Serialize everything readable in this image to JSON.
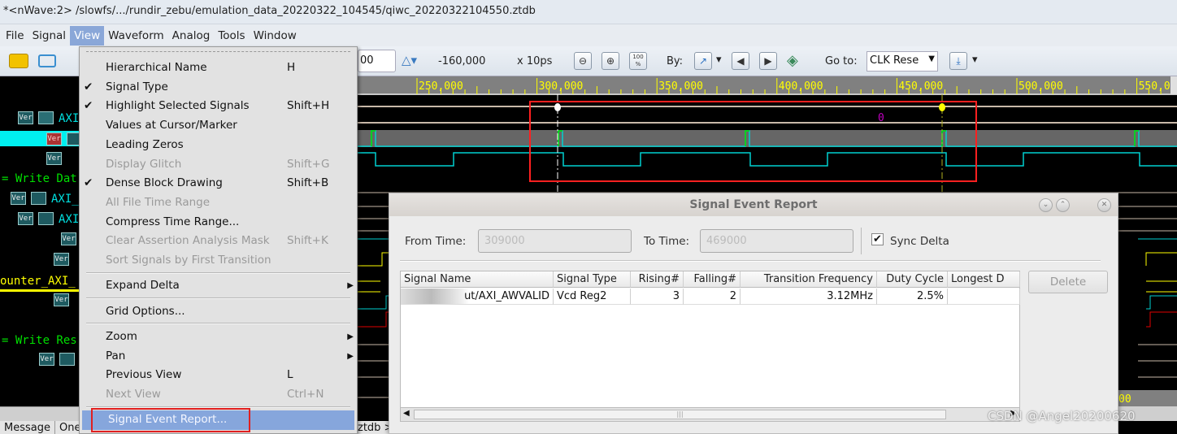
{
  "window": {
    "title": "*<nWave:2> /slowfs/.../rundir_zebu/emulation_data_20220322_104545/qiwc_20220322104550.ztdb"
  },
  "menubar": [
    "File",
    "Signal",
    "View",
    "Waveform",
    "Analog",
    "Tools",
    "Window"
  ],
  "toolbar": {
    "cursor_time_fragment": "00",
    "delta_value": "-160,000",
    "time_unit": "x 10ps",
    "zoom_100_label": "100 %",
    "by_label": "By:",
    "goto_label": "Go to:",
    "goto_value": "CLK Rese"
  },
  "ruler": {
    "ticks": [
      "250,000",
      "300,000",
      "350,000",
      "400,000",
      "450,000",
      "500,000",
      "550,000"
    ],
    "bottom_fragment": "00"
  },
  "waveform": {
    "value_label": "0",
    "cursor_color": "#ffffff",
    "marker_color": "#ffff00",
    "highlight_box_color": "#ff2020"
  },
  "signal_panel": {
    "rows": [
      {
        "label": "AXI",
        "color": "#00e0e0"
      },
      {
        "label": "",
        "color": "#00e0e0"
      },
      {
        "label": "= Write Dat",
        "color": "#00e000"
      },
      {
        "label": "AXI_",
        "color": "#00e0e0"
      },
      {
        "label": "AXI",
        "color": "#00e0e0"
      },
      {
        "label": "ounter_AXI_",
        "color": "#ffff00"
      },
      {
        "label": "= Write Res",
        "color": "#00e000"
      }
    ],
    "ver_icon_label": "Ver"
  },
  "bottom_tabs": [
    "Message",
    "One"
  ],
  "bottom_tab_fragment": "ztdb >",
  "view_menu": {
    "items": [
      {
        "label": "Hierarchical Name",
        "shortcut": "H",
        "checked": false,
        "disabled": false
      },
      {
        "label": "Signal Type",
        "shortcut": "",
        "checked": true,
        "disabled": false
      },
      {
        "label": "Highlight Selected Signals",
        "shortcut": "Shift+H",
        "checked": true,
        "disabled": false
      },
      {
        "label": "Values at Cursor/Marker",
        "shortcut": "",
        "checked": false,
        "disabled": false
      },
      {
        "label": "Leading Zeros",
        "shortcut": "",
        "checked": false,
        "disabled": false
      },
      {
        "label": "Display Glitch",
        "shortcut": "Shift+G",
        "checked": false,
        "disabled": true
      },
      {
        "label": "Dense Block Drawing",
        "shortcut": "Shift+B",
        "checked": true,
        "disabled": false
      },
      {
        "label": "All File Time Range",
        "shortcut": "",
        "checked": false,
        "disabled": true
      },
      {
        "label": "Compress Time Range...",
        "shortcut": "",
        "checked": false,
        "disabled": false
      },
      {
        "label": "Clear Assertion Analysis Mask",
        "shortcut": "Shift+K",
        "checked": false,
        "disabled": true
      },
      {
        "label": "Sort Signals by First Transition",
        "shortcut": "",
        "checked": false,
        "disabled": true
      },
      {
        "label": "Expand Delta",
        "shortcut": "",
        "submenu": true,
        "separator_before": true
      },
      {
        "label": "Grid Options...",
        "shortcut": "",
        "separator_before": true
      },
      {
        "label": "Zoom",
        "shortcut": "",
        "submenu": true,
        "separator_before": true
      },
      {
        "label": "Pan",
        "shortcut": "",
        "submenu": true
      },
      {
        "label": "Previous View",
        "shortcut": "L"
      },
      {
        "label": "Next View",
        "shortcut": "Ctrl+N",
        "disabled": true
      },
      {
        "label": "Signal Event Report...",
        "shortcut": "",
        "separator_before": true,
        "highlighted": true
      }
    ]
  },
  "dialog": {
    "title": "Signal Event Report",
    "from_label": "From Time:",
    "from_value": "309000",
    "to_label": "To Time:",
    "to_value": "469000",
    "sync_delta_label": "Sync Delta",
    "sync_delta_checked": true,
    "delete_label": "Delete",
    "columns": [
      "Signal Name",
      "Signal Type",
      "Rising#",
      "Falling#",
      "Transition Frequency",
      "Duty Cycle",
      "Longest D"
    ],
    "rows": [
      [
        "ut/AXI_AWVALID",
        "Vcd Reg2",
        "3",
        "2",
        "3.12MHz",
        "2.5%",
        ""
      ]
    ]
  },
  "watermark": "CSDN @Angel20200620"
}
